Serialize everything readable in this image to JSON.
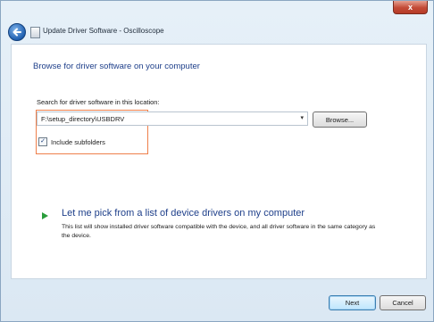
{
  "window": {
    "title": "Update Driver Software - Oscilloscope",
    "close_glyph": "x",
    "back_icon": "back-arrow-icon",
    "app_icon": "device-icon"
  },
  "main": {
    "heading": "Browse for driver software on your computer",
    "search_label": "Search for driver software in this location:",
    "path_value": "F:\\setup_directory\\USBDRV",
    "combo_arrow": "▾",
    "browse_label": "Browse...",
    "include_subfolders": {
      "label": "Include subfolders",
      "checked": true,
      "check_glyph": "✓"
    },
    "pick": {
      "link": "Let me pick from a list of device drivers on my computer",
      "description": "This list will show installed driver software compatible with the device, and all driver software in the same category as the device."
    }
  },
  "footer": {
    "next_label": "Next",
    "cancel_label": "Cancel"
  },
  "colors": {
    "link": "#1e3f8a",
    "highlight_border": "#ef7f4a",
    "pick_arrow": "#2a9d3b"
  }
}
